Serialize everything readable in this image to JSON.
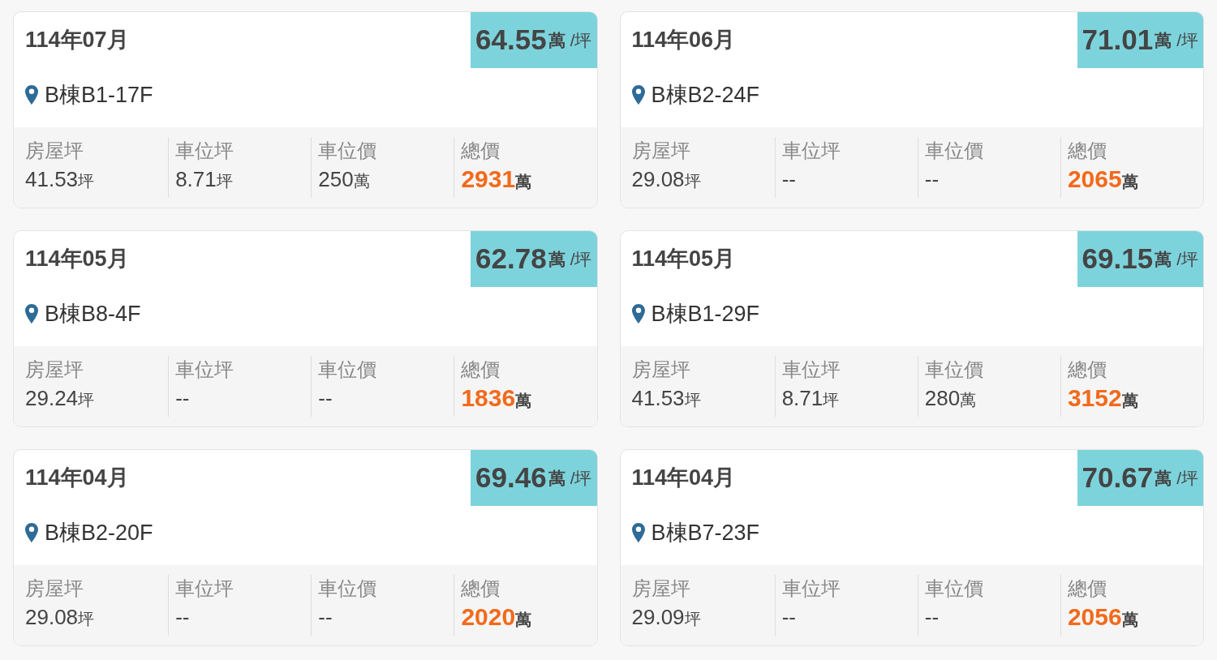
{
  "cards": [
    {
      "month": "114年07月",
      "price": "64.55",
      "price_unit": "萬",
      "per": "/坪",
      "location": "B棟B1-17F",
      "stats": [
        {
          "kind": "plain",
          "label": "房屋坪",
          "value": "41.53",
          "unit": "坪"
        },
        {
          "kind": "plain",
          "label": "車位坪",
          "value": "8.71",
          "unit": "坪"
        },
        {
          "kind": "plain",
          "label": "車位價",
          "value": "250",
          "unit": "萬"
        },
        {
          "kind": "total",
          "label": "總價",
          "value": "2931",
          "unit": "萬"
        }
      ]
    },
    {
      "month": "114年06月",
      "price": "71.01",
      "price_unit": "萬",
      "per": "/坪",
      "location": "B棟B2-24F",
      "stats": [
        {
          "kind": "plain",
          "label": "房屋坪",
          "value": "29.08",
          "unit": "坪"
        },
        {
          "kind": "plain",
          "label": "車位坪",
          "value": "--"
        },
        {
          "kind": "plain",
          "label": "車位價",
          "value": "--"
        },
        {
          "kind": "total",
          "label": "總價",
          "value": "2065",
          "unit": "萬"
        }
      ]
    },
    {
      "month": "114年05月",
      "price": "62.78",
      "price_unit": "萬",
      "per": "/坪",
      "location": "B棟B8-4F",
      "stats": [
        {
          "kind": "plain",
          "label": "房屋坪",
          "value": "29.24",
          "unit": "坪"
        },
        {
          "kind": "plain",
          "label": "車位坪",
          "value": "--"
        },
        {
          "kind": "plain",
          "label": "車位價",
          "value": "--"
        },
        {
          "kind": "total",
          "label": "總價",
          "value": "1836",
          "unit": "萬"
        }
      ]
    },
    {
      "month": "114年05月",
      "price": "69.15",
      "price_unit": "萬",
      "per": "/坪",
      "location": "B棟B1-29F",
      "stats": [
        {
          "kind": "plain",
          "label": "房屋坪",
          "value": "41.53",
          "unit": "坪"
        },
        {
          "kind": "plain",
          "label": "車位坪",
          "value": "8.71",
          "unit": "坪"
        },
        {
          "kind": "plain",
          "label": "車位價",
          "value": "280",
          "unit": "萬"
        },
        {
          "kind": "total",
          "label": "總價",
          "value": "3152",
          "unit": "萬"
        }
      ]
    },
    {
      "month": "114年04月",
      "price": "69.46",
      "price_unit": "萬",
      "per": "/坪",
      "location": "B棟B2-20F",
      "stats": [
        {
          "kind": "plain",
          "label": "房屋坪",
          "value": "29.08",
          "unit": "坪"
        },
        {
          "kind": "plain",
          "label": "車位坪",
          "value": "--"
        },
        {
          "kind": "plain",
          "label": "車位價",
          "value": "--"
        },
        {
          "kind": "total",
          "label": "總價",
          "value": "2020",
          "unit": "萬"
        }
      ]
    },
    {
      "month": "114年04月",
      "price": "70.67",
      "price_unit": "萬",
      "per": "/坪",
      "location": "B棟B7-23F",
      "stats": [
        {
          "kind": "plain",
          "label": "房屋坪",
          "value": "29.09",
          "unit": "坪"
        },
        {
          "kind": "plain",
          "label": "車位坪",
          "value": "--"
        },
        {
          "kind": "plain",
          "label": "車位價",
          "value": "--"
        },
        {
          "kind": "total",
          "label": "總價",
          "value": "2056",
          "unit": "萬"
        }
      ]
    }
  ]
}
